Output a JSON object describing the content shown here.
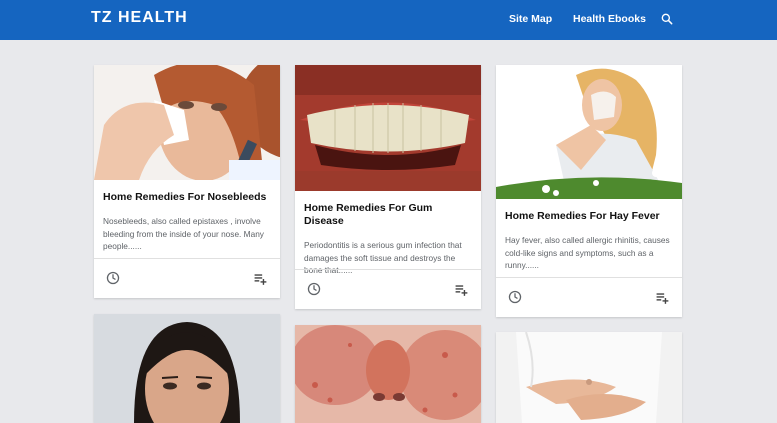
{
  "header": {
    "brand": "TZ HEALTH",
    "nav": [
      "Site Map",
      "Health Ebooks"
    ],
    "search_icon": "search-icon"
  },
  "colors": {
    "header_bg": "#1565c0",
    "page_bg": "#e8e9ec"
  },
  "cards": [
    {
      "title": "Home Remedies For Nosebleeds",
      "excerpt": "Nosebleeds, also called epistaxes , involve bleeding from the inside of your nose. Many people......",
      "image": "woman holding tissue to nose"
    },
    {
      "title": "Home Remedies For Gum Disease",
      "excerpt": "Periodontitis is a serious gum infection that damages the soft tissue and destroys the bone that......",
      "image": "close-up of teeth and gums"
    },
    {
      "title": "Home Remedies For Hay Fever",
      "excerpt": "Hay fever, also called allergic rhinitis, causes cold-like signs and symptoms, such as a runny......",
      "image": "woman sneezing in a flower field"
    },
    {
      "image": "face portrait"
    },
    {
      "image": "skin rash on face"
    },
    {
      "image": "person holding stomach"
    }
  ],
  "card_footer_icons": [
    "clock-icon",
    "playlist-add-icon"
  ]
}
